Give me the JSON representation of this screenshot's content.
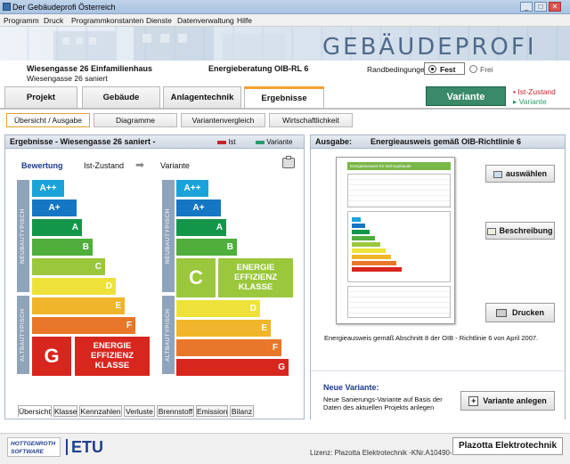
{
  "window": {
    "title": "Der Gebäudeprofi Österreich",
    "minimize": "_",
    "maximize": "□",
    "close": "✕"
  },
  "menu": [
    "Programm",
    "Druck",
    "Programmkonstanten",
    "Dienste",
    "Datenverwaltung",
    "Hilfe"
  ],
  "banner": {
    "brand": "GEBÄUDEPROFI"
  },
  "project": {
    "name": "Wiesengasse 26 Einfamilienhaus",
    "variant": "Wiesengasse 26 saniert",
    "consulting": "Energieberatung OIB-RL 6",
    "conditions_label": "Randbedingungen:",
    "option_fest": "Fest",
    "option_frei": "Frei"
  },
  "tabs": [
    "Projekt",
    "Gebäude",
    "Anlagentechnik",
    "Ergebnisse"
  ],
  "variant_button": "Variante",
  "legend_right": {
    "ist": "Ist-Zustand",
    "variante": "Variante"
  },
  "subtabs": [
    "Übersicht / Ausgabe",
    "Diagramme",
    "Variantenvergleich",
    "Wirtschaftlichkeit"
  ],
  "left_panel": {
    "title": "Ergebnisse - Wiesengasse 26 saniert -",
    "legend_ist": "Ist",
    "legend_variante": "Variante",
    "bewertung": "Bewertung",
    "ist_zustand": "Ist-Zustand",
    "arrow": "➡",
    "variante": "Variante",
    "neubau": "NEUBAUTYPISCH",
    "altbau": "ALTBAUTYPISCH",
    "classes": [
      "A++",
      "A+",
      "A",
      "B",
      "C",
      "D",
      "E",
      "F",
      "G"
    ],
    "ist_rating": "G",
    "variante_rating": "C",
    "effizienz_text": "ENERGIE EFFIZIENZ KLASSE",
    "bottom_tabs": [
      "Übersicht",
      "Klasse",
      "Kennzahlen",
      "Verluste",
      "Brennstoff",
      "Emission",
      "Bilanz"
    ]
  },
  "right_panel": {
    "title_prefix": "Ausgabe:",
    "title": "Energieausweis gemäß OIB-Richtlinie 6",
    "doc_header": "Energieausweis für Wohngebäude",
    "btn_select": "auswählen",
    "btn_description": "Beschreibung",
    "btn_print": "Drucken",
    "caption": "Energieausweis gemäß Abschnitt 8 der OIB - Richtlinie 6 von April 2007.",
    "new_variant_title": "Neue Variante:",
    "new_variant_text": "Neue Sanierungs-Variante auf Basis der Daten des aktuellen Projekts anlegen",
    "btn_new_variant": "Variante anlegen"
  },
  "footer": {
    "logo1": "HOTTGENROTH SOFTWARE",
    "logo2": "ETU",
    "license": "Lizenz: Plazotta Elektrotechnik  -KNr.A10490-",
    "company": "Plazotta Elektrotechnik"
  },
  "colors": {
    "App": "#3a8a6a",
    "A++": "#1aa3d9",
    "A+": "#1576c4",
    "A": "#13964a",
    "B": "#4fae3c",
    "C": "#9ac73c",
    "D": "#eee23a",
    "E": "#f0b52a",
    "F": "#e8772a",
    "G": "#d7261e"
  }
}
